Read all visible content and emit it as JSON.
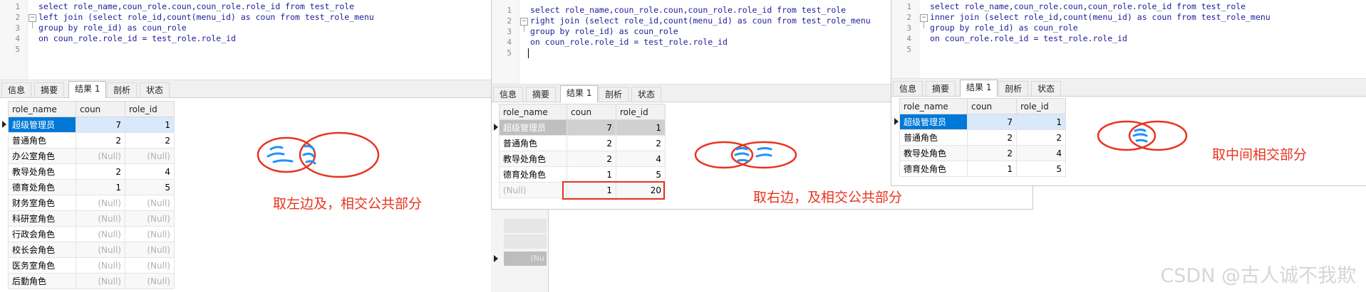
{
  "panels": [
    {
      "code": [
        "select role_name,coun_role.coun,coun_role.role_id from test_role",
        "left join (select role_id,count(menu_id) as coun from test_role_menu",
        "group by role_id) as coun_role",
        "on coun_role.role_id = test_role.role_id"
      ],
      "line_numbers": [
        "1",
        "2",
        "3",
        "4",
        "5"
      ],
      "tabs": [
        "信息",
        "摘要",
        "结果 1",
        "剖析",
        "状态"
      ],
      "columns": [
        "role_name",
        "coun",
        "role_id"
      ],
      "rows": [
        [
          "超级管理员",
          "7",
          "1"
        ],
        [
          "普通角色",
          "2",
          "2"
        ],
        [
          "办公室角色",
          "(Null)",
          "(Null)"
        ],
        [
          "教导处角色",
          "2",
          "4"
        ],
        [
          "德育处角色",
          "1",
          "5"
        ],
        [
          "财务室角色",
          "(Null)",
          "(Null)"
        ],
        [
          "科研室角色",
          "(Null)",
          "(Null)"
        ],
        [
          "行政会角色",
          "(Null)",
          "(Null)"
        ],
        [
          "校长会角色",
          "(Null)",
          "(Null)"
        ],
        [
          "医务室角色",
          "(Null)",
          "(Null)"
        ],
        [
          "后勤角色",
          "(Null)",
          "(Null)"
        ]
      ],
      "note": "取左边及，相交公共部分"
    },
    {
      "code": [
        "select role_name,coun_role.coun,coun_role.role_id from test_role",
        "right join (select role_id,count(menu_id) as coun from test_role_menu",
        "group by role_id) as coun_role",
        "on coun_role.role_id = test_role.role_id",
        ""
      ],
      "line_numbers": [
        "1",
        "2",
        "3",
        "4",
        "5"
      ],
      "tabs": [
        "信息",
        "摘要",
        "结果 1",
        "剖析",
        "状态"
      ],
      "columns": [
        "role_name",
        "coun",
        "role_id"
      ],
      "rows": [
        [
          "超级管理员",
          "7",
          "1"
        ],
        [
          "普通角色",
          "2",
          "2"
        ],
        [
          "教导处角色",
          "2",
          "4"
        ],
        [
          "德育处角色",
          "1",
          "5"
        ],
        [
          "(Null)",
          "1",
          "20"
        ]
      ],
      "note": "取右边，及相交公共部分"
    },
    {
      "code": [
        "select role_name,coun_role.coun,coun_role.role_id from test_role",
        "inner join (select role_id,count(menu_id) as coun from test_role_menu",
        "group by role_id) as coun_role",
        "on coun_role.role_id = test_role.role_id"
      ],
      "line_numbers": [
        "1",
        "2",
        "3",
        "4",
        "5"
      ],
      "tabs": [
        "信息",
        "摘要",
        "结果 1",
        "剖析",
        "状态"
      ],
      "columns": [
        "role_name",
        "coun",
        "role_id"
      ],
      "rows": [
        [
          "超级管理员",
          "7",
          "1"
        ],
        [
          "普通角色",
          "2",
          "2"
        ],
        [
          "教导处角色",
          "2",
          "4"
        ],
        [
          "德育处角色",
          "1",
          "5"
        ]
      ],
      "note": "取中间相交部分"
    }
  ],
  "ghost": {
    "null_label": "(Nu"
  },
  "watermark": "CSDN @古人诚不我欺",
  "colors": {
    "annotation": "#e8331f",
    "selection": "#0078d7",
    "doodle": "#1e90ff",
    "keyword": "#1d1d9a"
  },
  "icons": [
    "fold-toggle-icon",
    "row-pointer-icon",
    "venn-diagram-icon"
  ]
}
